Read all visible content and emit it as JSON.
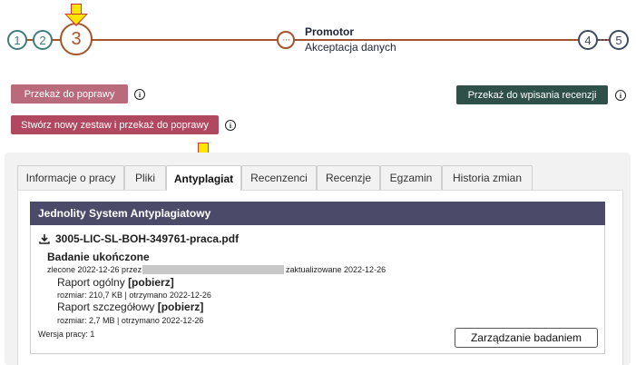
{
  "stepper": {
    "steps": [
      "1",
      "2",
      "3",
      "4",
      "5"
    ],
    "current_dots": "···",
    "current_title": "Promotor",
    "current_subtitle": "Akceptacja danych"
  },
  "actions": {
    "forward_to_correction": "Przekaż do poprawy",
    "create_set_and_forward": "Stwórz nowy zestaw i przekaż do poprawy",
    "forward_to_review": "Przekaż do wpisania recenzji",
    "info_glyph": "i"
  },
  "tabs": [
    {
      "label": "Informacje o pracy"
    },
    {
      "label": "Pliki"
    },
    {
      "label": "Antyplagiat"
    },
    {
      "label": "Recenzenci"
    },
    {
      "label": "Recenzje"
    },
    {
      "label": "Egzamin"
    },
    {
      "label": "Historia zmian"
    }
  ],
  "panel": {
    "title": "Jednolity System Antyplagiatowy",
    "file_name": "3005-LIC-SL-BOH-349761-praca.pdf",
    "status": "Badanie ukończone",
    "ordered": "zlecone 2022-12-26 przez",
    "updated": "zaktualizowane 2022-12-26",
    "general_report_label": "Raport ogólny",
    "general_report_link": "[pobierz]",
    "general_report_meta": "rozmiar: 210,7 KB | otrzymano 2022-12-26",
    "detailed_report_label": "Raport szczegółowy",
    "detailed_report_link": "[pobierz]",
    "detailed_report_meta": "rozmiar: 2,7 MB | otrzymano 2022-12-26",
    "version": "Wersja pracy: 1",
    "manage_button": "Zarządzanie badaniem"
  },
  "colors": {
    "accent": "#a4552e",
    "done": "#3e7d7a",
    "todo": "#3e4a60",
    "panel_header": "#4b4a68",
    "highlight_arrow": "#ffe600"
  }
}
